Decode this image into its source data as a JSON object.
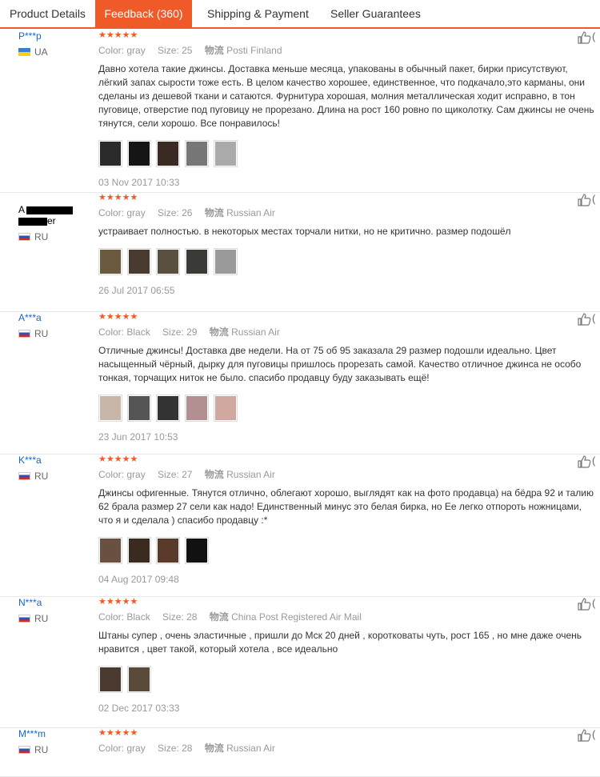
{
  "tabs": [
    {
      "label": "Product Details"
    },
    {
      "label": "Feedback (360)"
    },
    {
      "label": "Shipping & Payment"
    },
    {
      "label": "Seller Guarantees"
    }
  ],
  "stars": "★★★★★",
  "meta_labels": {
    "color": "Color:",
    "size": "Size:",
    "ship": "物流"
  },
  "like_count_visible": "(",
  "reviews": [
    {
      "user": "P***p",
      "country": "UA",
      "flag": "ua",
      "color": "gray",
      "size": "25",
      "shipping": "Posti Finland",
      "text": "Давно хотела такие джинсы. Доставка меньше месяца, упакованы в обычный пакет, бирки присутствуют, лёгкий запах сырости тоже есть. В целом качество хорошее, единственное, что подкачало,это карманы, они сделаны из дешевой ткани и сатаются. Фурнитура хорошая, молния металлическая ходит исправно, в тон пуговице, отверстие под пуговицу не прорезано. Длина на рост 160 ровно по щиколотку. Сам джинсы не очень тянутся, сели хорошо. Все понравилось!",
      "photos": [
        "#2a2a2a",
        "#151515",
        "#3a2a22",
        "#777777",
        "#aaaaaa"
      ],
      "date": "03 Nov 2017 10:33"
    },
    {
      "user": "A",
      "user2": "er",
      "country": "RU",
      "flag": "ru",
      "color": "gray",
      "size": "26",
      "shipping": "Russian Air",
      "text": "устраивает полностью. в некоторых местах торчали нитки, но не критично. размер подошёл",
      "photos": [
        "#6b5a40",
        "#4a3b30",
        "#5a5040",
        "#3a3a36",
        "#9a9a9a"
      ],
      "date": "26 Jul 2017 06:55"
    },
    {
      "user": "A***a",
      "country": "RU",
      "flag": "ru",
      "color": "Black",
      "size": "29",
      "shipping": "Russian Air",
      "text": "Отличные джинсы! Доставка две недели. На от 75 об 95 заказала 29 размер подошли идеально. Цвет насыщенный чёрный, дырку для пуговицы пришлось прорезать самой. Качество отличное джинса не особо тонкая, торчащих ниток не было. спасибо продавцу буду заказывать ещё!",
      "photos": [
        "#c8b6a8",
        "#555555",
        "#333333",
        "#b09090",
        "#d0a8a0"
      ],
      "date": "23 Jun 2017 10:53"
    },
    {
      "user": "K***a",
      "country": "RU",
      "flag": "ru",
      "color": "gray",
      "size": "27",
      "shipping": "Russian Air",
      "text": "Джинсы офигенные. Тянутся отлично, облегают хорошо, выглядят как на фото продавца) на бёдра 92 и талию 62 брала размер 27 сели как надо! Единственный минус это белая бирка, но Ее легко отпороть ножницами, что я и сделала ) спасибо продавцу :*",
      "photos": [
        "#6a5040",
        "#3a2a20",
        "#5a3a2a",
        "#111111"
      ],
      "date": "04 Aug 2017 09:48"
    },
    {
      "user": "N***a",
      "country": "RU",
      "flag": "ru",
      "color": "Black",
      "size": "28",
      "shipping": "China Post Registered Air Mail",
      "text": "Штаны супер , очень эластичные , пришли до Мск 20 дней , коротковаты чуть, рост 165 , но мне даже очень нравится , цвет такой, который хотела , все идеально",
      "photos": [
        "#4a3a30",
        "#5a4a3a"
      ],
      "date": "02 Dec 2017 03:33"
    },
    {
      "user": "M***m",
      "country": "RU",
      "flag": "ru",
      "color": "gray",
      "size": "28",
      "shipping": "Russian Air",
      "text": "",
      "photos": [],
      "date": ""
    }
  ]
}
